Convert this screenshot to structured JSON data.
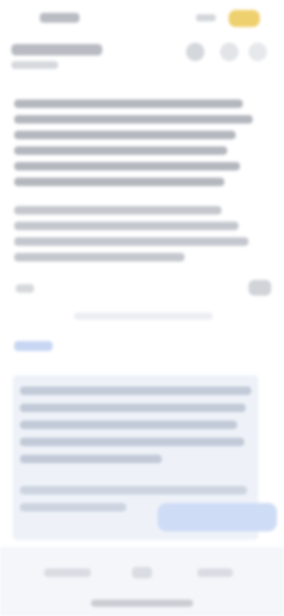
{
  "colors": {
    "accent": "#efd06e",
    "link": "#c7d6f2",
    "card_background": "#eef2f8",
    "cta_background": "#cfdcf6"
  },
  "icons": [
    "more-icon",
    "share-icon",
    "menu-icon"
  ]
}
